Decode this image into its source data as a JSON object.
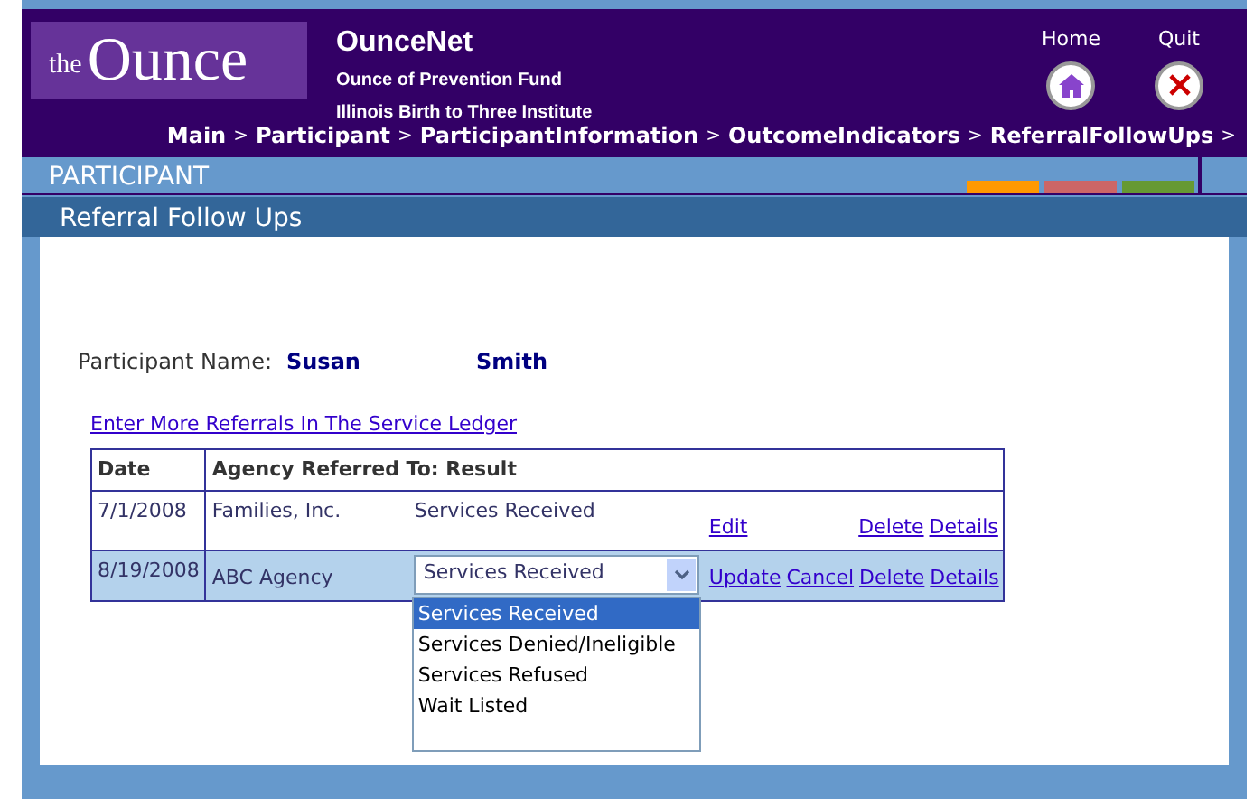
{
  "header": {
    "logo_prefix": "the",
    "logo_name": "Ounce",
    "app_name": "OunceNet",
    "subtitle_1": "Ounce of Prevention Fund",
    "subtitle_2": "Illinois Birth to Three Institute",
    "home_label": "Home",
    "quit_label": "Quit"
  },
  "breadcrumb": [
    {
      "label": "Main",
      "separator": ">"
    },
    {
      "label": "Participant",
      "separator": ">"
    },
    {
      "label": "ParticipantInformation",
      "separator": ">"
    },
    {
      "label": "OutcomeIndicators",
      "separator": ">"
    },
    {
      "label": "ReferralFollowUps",
      "separator": ">"
    }
  ],
  "section": "PARTICIPANT",
  "section_tabs": [
    {
      "color": "#ff9900"
    },
    {
      "color": "#cc6666"
    },
    {
      "color": "#669933"
    }
  ],
  "page_title": "Referral Follow Ups",
  "participant": {
    "label": "Participant Name:",
    "first_name": "Susan",
    "last_name": "Smith"
  },
  "ledger_link": "Enter More Referrals In The Service Ledger",
  "table": {
    "columns": [
      "Date",
      "Agency Referred To: Result"
    ],
    "rows": [
      {
        "date": "7/1/2008",
        "agency": "Families, Inc.",
        "editing": false,
        "result": "Services Received",
        "actions": [
          "Edit",
          "Delete",
          "Details"
        ]
      },
      {
        "date": "8/19/2008",
        "agency": "ABC Agency",
        "editing": true,
        "result_select": {
          "value": "Services Received",
          "options": [
            {
              "label": "Services Received",
              "selected": true
            },
            {
              "label": "Services Denied/Ineligible",
              "selected": false
            },
            {
              "label": "Services Refused",
              "selected": false
            },
            {
              "label": "Wait Listed",
              "selected": false
            }
          ]
        },
        "actions": [
          "Update",
          "Cancel",
          "Delete",
          "Details"
        ]
      }
    ]
  }
}
